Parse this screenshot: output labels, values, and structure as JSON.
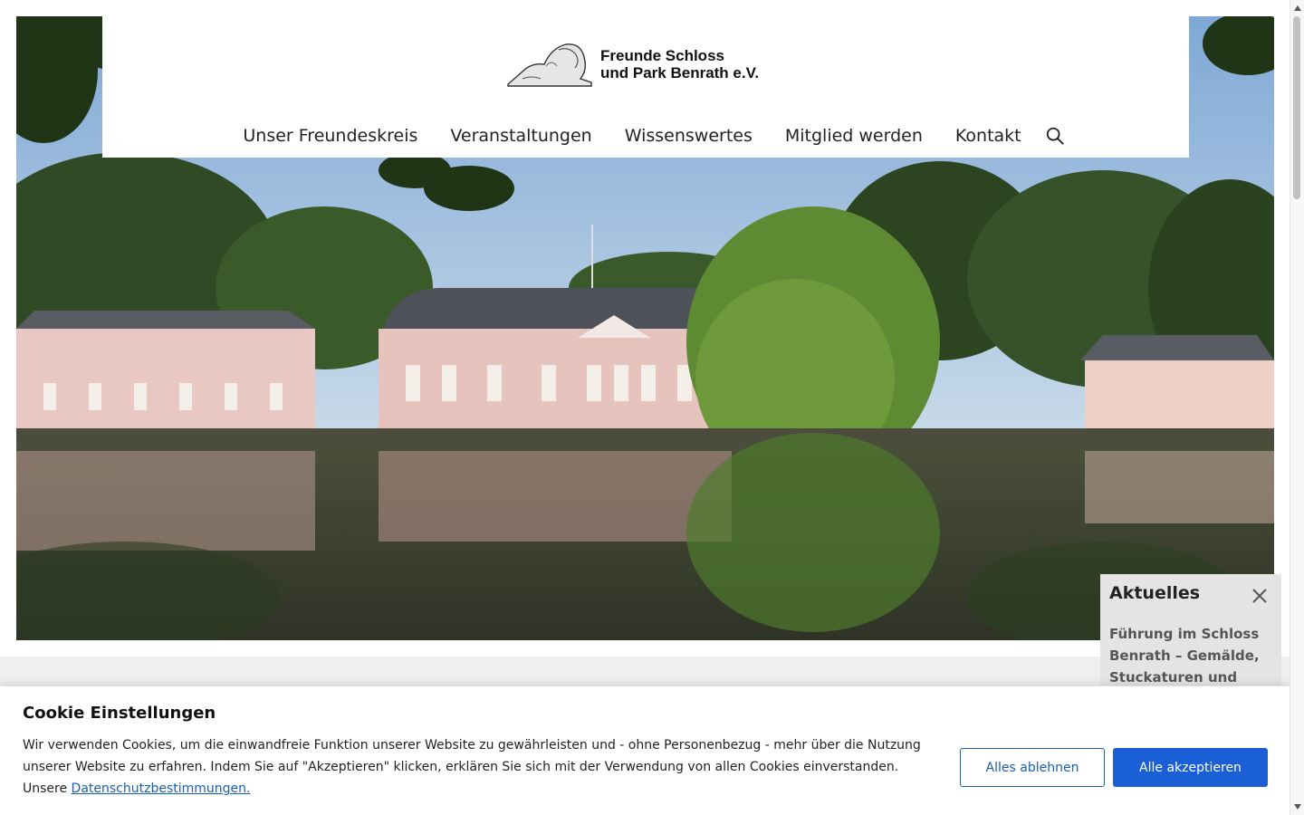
{
  "header": {
    "logo_line1": "Freunde Schloss",
    "logo_line2": "und Park Benrath e.V.",
    "nav": [
      "Unser Freundeskreis",
      "Veranstaltungen",
      "Wissenswertes",
      "Mitglied werden",
      "Kontakt"
    ]
  },
  "news": {
    "title": "Aktuelles",
    "teaser": "Führung im Schloss Benrath – Gemälde, Stuckaturen und"
  },
  "cookie": {
    "title": "Cookie Einstellungen",
    "text": "Wir verwenden Cookies, um die einwandfreie Funktion unserer Website zu gewährleisten und - ohne Personenbezug - mehr über die Nutzung unserer Website zu erfahren. Indem Sie auf \"Akzeptieren\" klicken, erklären Sie sich mit der Verwendung von allen Cookies einverstanden. Unsere ",
    "link": "Datenschutzbestimmungen.",
    "reject": "Alles ablehnen",
    "accept": "Alle akzeptieren"
  },
  "colors": {
    "accent": "#1a5fd6",
    "link": "#1a5fb4",
    "band": "#efefef",
    "news_bg": "#e6e4e3"
  },
  "icons": [
    "search-icon",
    "close-icon",
    "lion-logo-icon"
  ]
}
